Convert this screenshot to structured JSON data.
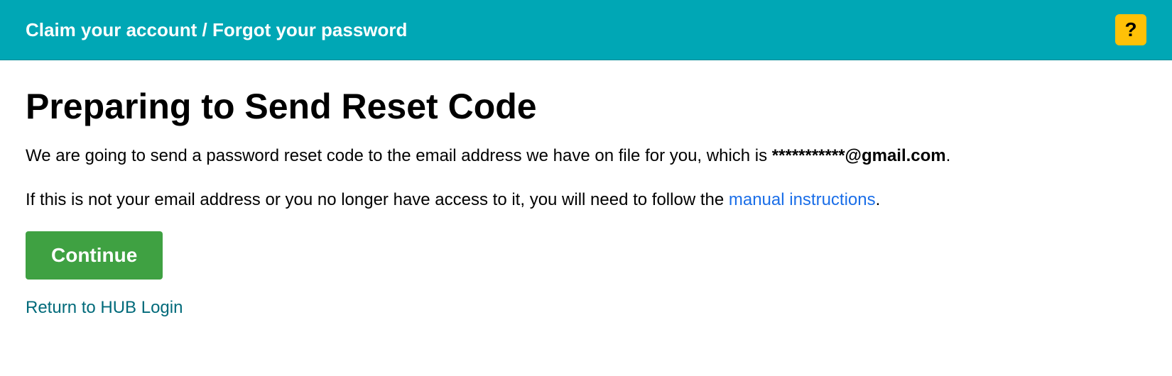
{
  "header": {
    "title": "Claim your account / Forgot your password",
    "help_icon": "?"
  },
  "main": {
    "heading": "Preparing to Send Reset Code",
    "paragraph1_prefix": "We are going to send a password reset code to the email address we have on file for you, which is ",
    "masked_email": "***********@gmail.com",
    "paragraph1_suffix": ".",
    "paragraph2_prefix": "If this is not your email address or you no longer have access to it, you will need to follow the ",
    "manual_link_text": "manual instructions",
    "paragraph2_suffix": ".",
    "continue_label": "Continue",
    "return_link_text": "Return to HUB Login"
  }
}
